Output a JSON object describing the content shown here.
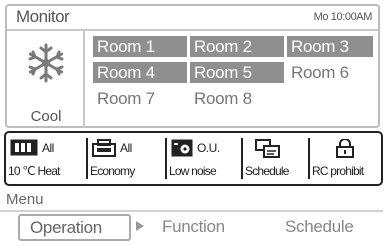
{
  "monitor": {
    "title": "Monitor",
    "clock": "Mo 10:00AM",
    "mode_label": "Cool",
    "mode_icon": "snowflake-icon"
  },
  "rooms": [
    {
      "label": "Room 1",
      "active": true
    },
    {
      "label": "Room 2",
      "active": true
    },
    {
      "label": "Room 3",
      "active": true
    },
    {
      "label": "Room 4",
      "active": true
    },
    {
      "label": "Room 5",
      "active": true
    },
    {
      "label": "Room 6",
      "active": false
    },
    {
      "label": "Room 7",
      "active": false
    },
    {
      "label": "Room 8",
      "active": false
    }
  ],
  "status": {
    "heat": {
      "icon": "heater-icon",
      "value": "All",
      "label": "10 ℃ Heat"
    },
    "economy": {
      "icon": "economy-icon",
      "value": "All",
      "label": "Economy"
    },
    "low_noise": {
      "icon": "outdoor-unit-icon",
      "value": "O.U.",
      "label": "Low noise"
    },
    "schedule": {
      "icon": "schedule-icon",
      "label": "Schedule"
    },
    "rc_prohibit": {
      "icon": "lock-icon",
      "label": "RC prohibit"
    }
  },
  "menu": {
    "title": "Menu",
    "operation": "Operation",
    "function": "Function",
    "schedule": "Schedule"
  },
  "colors": {
    "room_active_bg": "#8f8f8f",
    "room_active_text": "#ffffff",
    "status_border": "#222222"
  }
}
